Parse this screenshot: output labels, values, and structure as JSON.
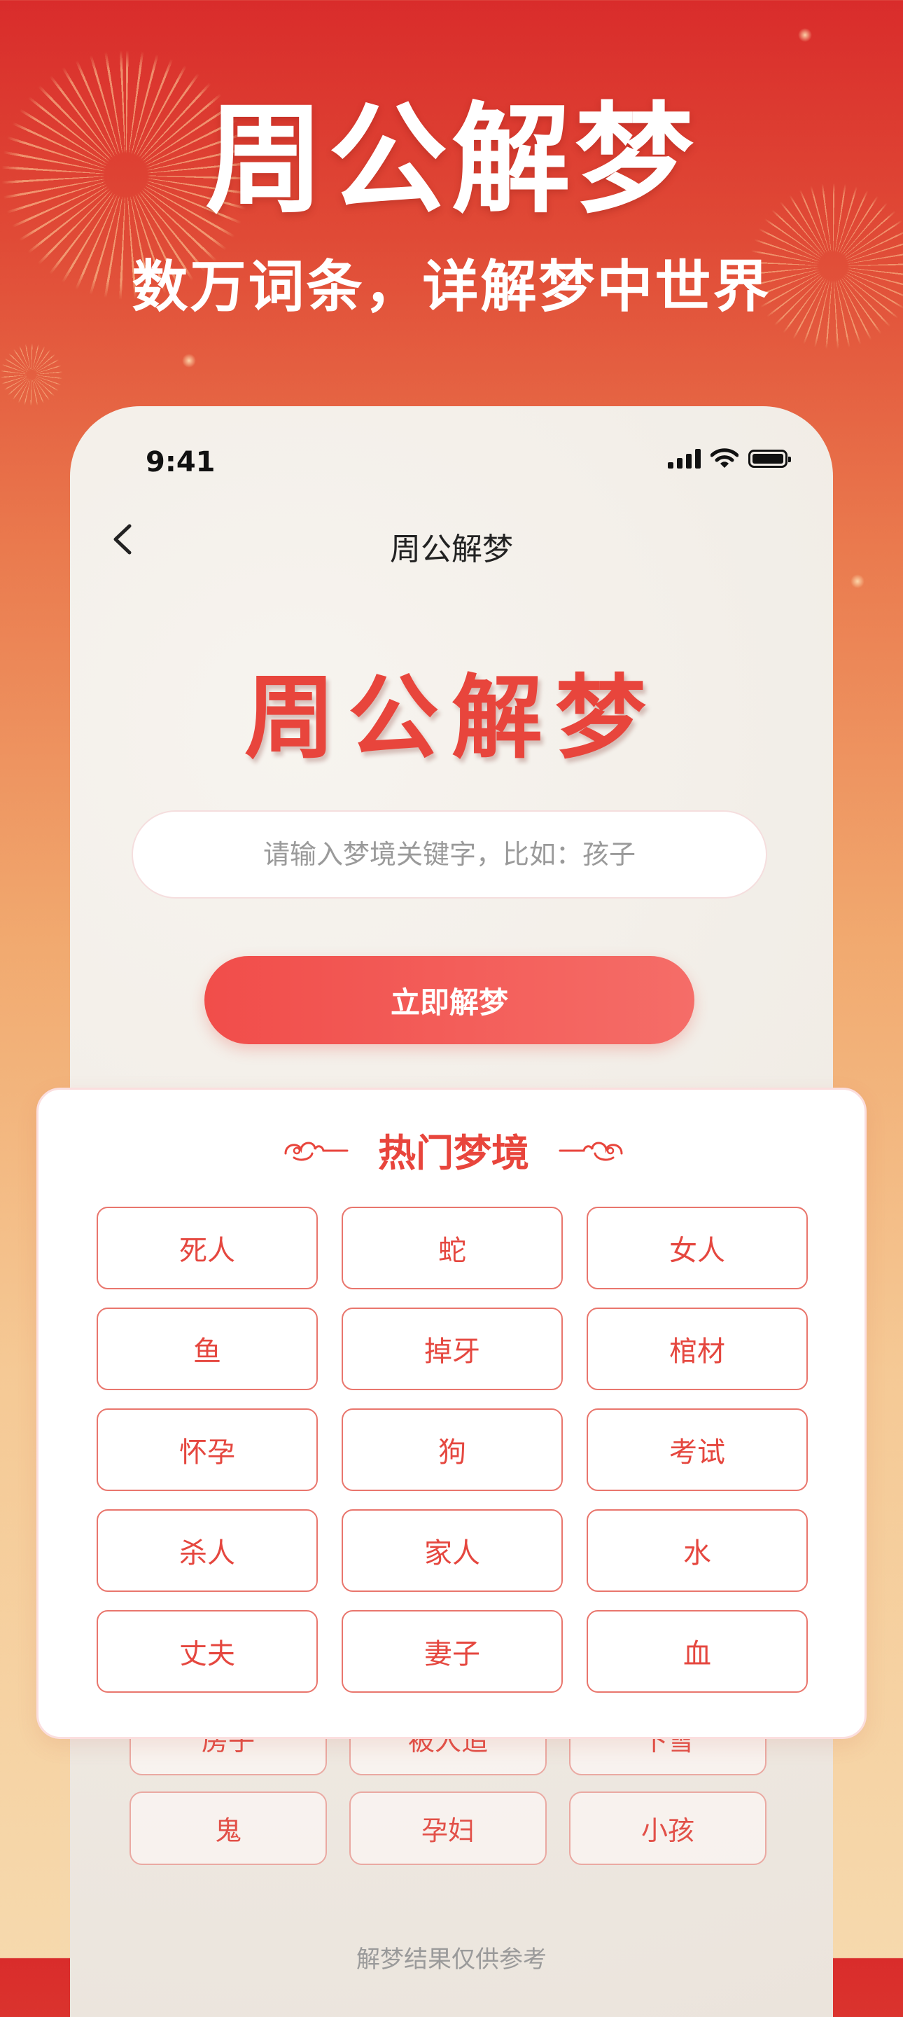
{
  "hero": {
    "title": "周公解梦",
    "subtitle": "数万词条，详解梦中世界"
  },
  "status_bar": {
    "time": "9:41",
    "icons": [
      "signal-icon",
      "wifi-icon",
      "battery-icon"
    ]
  },
  "nav": {
    "back_icon": "chevron-left-icon",
    "title": "周公解梦"
  },
  "main": {
    "calligraphy_title": "周公解梦",
    "search_placeholder": "请输入梦境关键字，比如：孩子",
    "submit_label": "立即解梦"
  },
  "hot_dreams": {
    "title": "热门梦境",
    "decor_icon": "auspicious-cloud-icon",
    "tags": [
      "死人",
      "蛇",
      "女人",
      "鱼",
      "掉牙",
      "棺材",
      "怀孕",
      "狗",
      "考试",
      "杀人",
      "家人",
      "水",
      "丈夫",
      "妻子",
      "血"
    ]
  },
  "more_dreams": {
    "tags": [
      "房子",
      "被人追",
      "下雪",
      "鬼",
      "孕妇",
      "小孩"
    ]
  },
  "footer": {
    "disclaimer": "解梦结果仅供参考"
  },
  "colors": {
    "accent": "#e8453c",
    "button_start": "#f14d4a",
    "button_end": "#f56d68",
    "background_top": "#d92c2b",
    "background_bottom": "#f6d9ad"
  }
}
